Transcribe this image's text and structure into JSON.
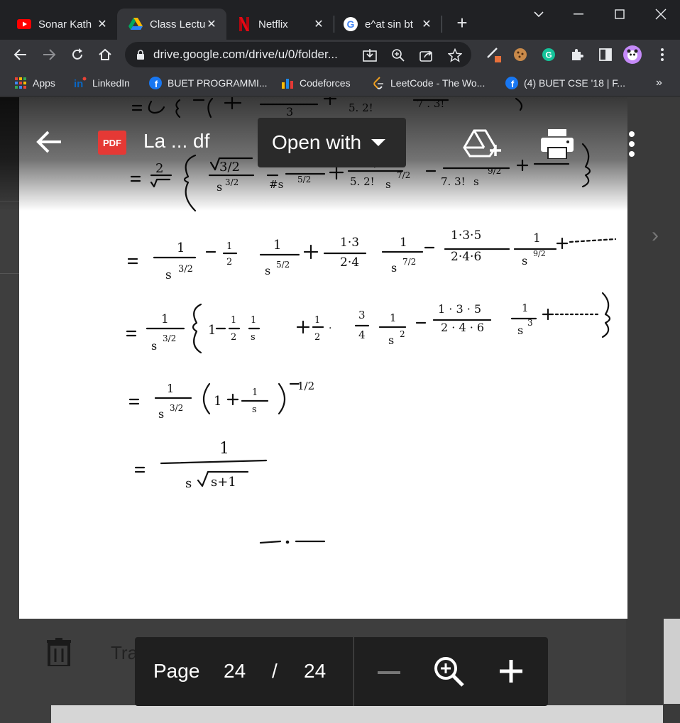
{
  "tabs": [
    {
      "title": "Sonar Kath",
      "favicon": "youtube-icon"
    },
    {
      "title": "Class Lectu",
      "favicon": "google-drive-icon",
      "active": true
    },
    {
      "title": "Netflix",
      "favicon": "netflix-icon"
    },
    {
      "title": "e^at sin bt",
      "favicon": "google-icon"
    }
  ],
  "toolbar": {
    "url": "drive.google.com/drive/u/0/folder..."
  },
  "bookmarks": [
    {
      "label": "Apps",
      "icon": "apps-grid-icon"
    },
    {
      "label": "LinkedIn",
      "icon": "linkedin-icon"
    },
    {
      "label": "BUET PROGRAMMI...",
      "icon": "facebook-icon"
    },
    {
      "label": "Codeforces",
      "icon": "codeforces-icon"
    },
    {
      "label": "LeetCode - The Wo...",
      "icon": "leetcode-icon"
    },
    {
      "label": "(4) BUET CSE '18 | F...",
      "icon": "facebook-icon"
    }
  ],
  "viewer": {
    "badge": "PDF",
    "file_name": "La ... df",
    "open_with": "Open with"
  },
  "pagebar": {
    "page_word": "Page",
    "current": "24",
    "slash": "/",
    "total": "24"
  },
  "sidebar": {
    "trash_label": "Trash"
  },
  "colors": {
    "chrome_dark": "#202124",
    "chrome_toolbar": "#35363a",
    "pdf_badge": "#e53935"
  }
}
